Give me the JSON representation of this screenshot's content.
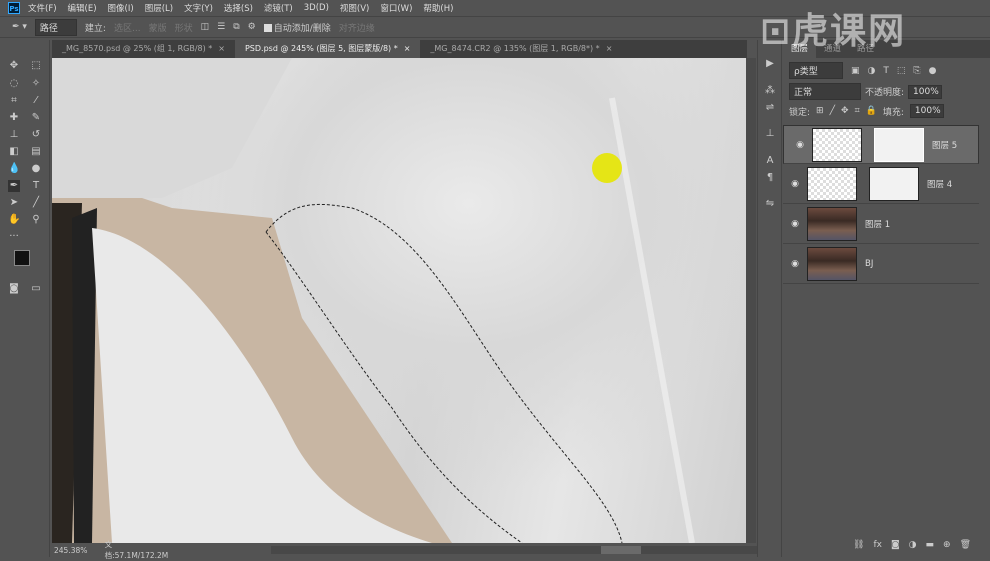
{
  "menu": [
    "文件(F)",
    "编辑(E)",
    "图像(I)",
    "图层(L)",
    "文字(Y)",
    "选择(S)",
    "滤镜(T)",
    "3D(D)",
    "视图(V)",
    "窗口(W)",
    "帮助(H)"
  ],
  "app_logo": "Ps",
  "options": {
    "mode": "路径",
    "build_label": "建立:",
    "selection": "选区...",
    "mask": "蒙版",
    "shape": "形状",
    "auto_add": "自动添加/删除",
    "align_edges": "对齐边缘"
  },
  "tabs": [
    {
      "label": "_MG_8570.psd @ 25% (组 1, RGB/8) *",
      "close": "×"
    },
    {
      "label": "PSD.psd @ 245% (图层 5, 图层蒙版/8) *",
      "close": "×"
    },
    {
      "label": "_MG_8474.CR2 @ 135% (图层 1, RGB/8*) *",
      "close": "×"
    }
  ],
  "status": {
    "zoom": "245.38%",
    "doc": "文档:57.1M/172.2M"
  },
  "panel": {
    "tabs": [
      "图层",
      "通道",
      "路径"
    ],
    "filter": "ρ类型",
    "blend": "正常",
    "opacity_label": "不透明度:",
    "opacity": "100%",
    "lock_label": "锁定:",
    "fill_label": "填充:",
    "fill": "100%"
  },
  "layers": [
    {
      "name": "图层 5",
      "selected": true
    },
    {
      "name": "图层 4",
      "selected": false
    },
    {
      "name": "图层 1",
      "selected": false
    },
    {
      "name": "BJ",
      "selected": false
    }
  ],
  "watermark": "虎课网",
  "colors": {
    "highlight": "#e6e600",
    "bg": "#535353"
  }
}
